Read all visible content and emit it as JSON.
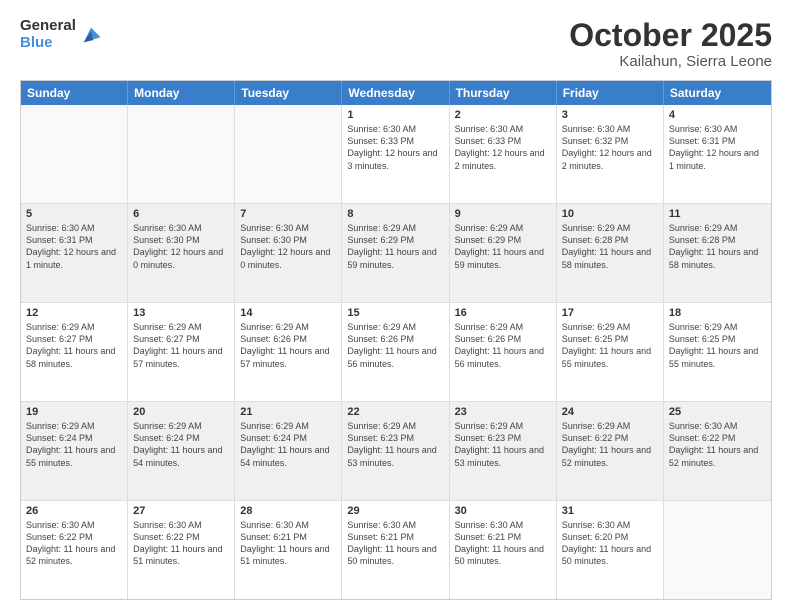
{
  "header": {
    "logo_general": "General",
    "logo_blue": "Blue",
    "title": "October 2025",
    "subtitle": "Kailahun, Sierra Leone"
  },
  "weekdays": [
    "Sunday",
    "Monday",
    "Tuesday",
    "Wednesday",
    "Thursday",
    "Friday",
    "Saturday"
  ],
  "rows": [
    [
      {
        "day": "",
        "text": "",
        "empty": true
      },
      {
        "day": "",
        "text": "",
        "empty": true
      },
      {
        "day": "",
        "text": "",
        "empty": true
      },
      {
        "day": "1",
        "text": "Sunrise: 6:30 AM\nSunset: 6:33 PM\nDaylight: 12 hours and 3 minutes.",
        "empty": false
      },
      {
        "day": "2",
        "text": "Sunrise: 6:30 AM\nSunset: 6:33 PM\nDaylight: 12 hours and 2 minutes.",
        "empty": false
      },
      {
        "day": "3",
        "text": "Sunrise: 6:30 AM\nSunset: 6:32 PM\nDaylight: 12 hours and 2 minutes.",
        "empty": false
      },
      {
        "day": "4",
        "text": "Sunrise: 6:30 AM\nSunset: 6:31 PM\nDaylight: 12 hours and 1 minute.",
        "empty": false
      }
    ],
    [
      {
        "day": "5",
        "text": "Sunrise: 6:30 AM\nSunset: 6:31 PM\nDaylight: 12 hours and 1 minute.",
        "empty": false,
        "shaded": true
      },
      {
        "day": "6",
        "text": "Sunrise: 6:30 AM\nSunset: 6:30 PM\nDaylight: 12 hours and 0 minutes.",
        "empty": false,
        "shaded": true
      },
      {
        "day": "7",
        "text": "Sunrise: 6:30 AM\nSunset: 6:30 PM\nDaylight: 12 hours and 0 minutes.",
        "empty": false,
        "shaded": true
      },
      {
        "day": "8",
        "text": "Sunrise: 6:29 AM\nSunset: 6:29 PM\nDaylight: 11 hours and 59 minutes.",
        "empty": false,
        "shaded": true
      },
      {
        "day": "9",
        "text": "Sunrise: 6:29 AM\nSunset: 6:29 PM\nDaylight: 11 hours and 59 minutes.",
        "empty": false,
        "shaded": true
      },
      {
        "day": "10",
        "text": "Sunrise: 6:29 AM\nSunset: 6:28 PM\nDaylight: 11 hours and 58 minutes.",
        "empty": false,
        "shaded": true
      },
      {
        "day": "11",
        "text": "Sunrise: 6:29 AM\nSunset: 6:28 PM\nDaylight: 11 hours and 58 minutes.",
        "empty": false,
        "shaded": true
      }
    ],
    [
      {
        "day": "12",
        "text": "Sunrise: 6:29 AM\nSunset: 6:27 PM\nDaylight: 11 hours and 58 minutes.",
        "empty": false
      },
      {
        "day": "13",
        "text": "Sunrise: 6:29 AM\nSunset: 6:27 PM\nDaylight: 11 hours and 57 minutes.",
        "empty": false
      },
      {
        "day": "14",
        "text": "Sunrise: 6:29 AM\nSunset: 6:26 PM\nDaylight: 11 hours and 57 minutes.",
        "empty": false
      },
      {
        "day": "15",
        "text": "Sunrise: 6:29 AM\nSunset: 6:26 PM\nDaylight: 11 hours and 56 minutes.",
        "empty": false
      },
      {
        "day": "16",
        "text": "Sunrise: 6:29 AM\nSunset: 6:26 PM\nDaylight: 11 hours and 56 minutes.",
        "empty": false
      },
      {
        "day": "17",
        "text": "Sunrise: 6:29 AM\nSunset: 6:25 PM\nDaylight: 11 hours and 55 minutes.",
        "empty": false
      },
      {
        "day": "18",
        "text": "Sunrise: 6:29 AM\nSunset: 6:25 PM\nDaylight: 11 hours and 55 minutes.",
        "empty": false
      }
    ],
    [
      {
        "day": "19",
        "text": "Sunrise: 6:29 AM\nSunset: 6:24 PM\nDaylight: 11 hours and 55 minutes.",
        "empty": false,
        "shaded": true
      },
      {
        "day": "20",
        "text": "Sunrise: 6:29 AM\nSunset: 6:24 PM\nDaylight: 11 hours and 54 minutes.",
        "empty": false,
        "shaded": true
      },
      {
        "day": "21",
        "text": "Sunrise: 6:29 AM\nSunset: 6:24 PM\nDaylight: 11 hours and 54 minutes.",
        "empty": false,
        "shaded": true
      },
      {
        "day": "22",
        "text": "Sunrise: 6:29 AM\nSunset: 6:23 PM\nDaylight: 11 hours and 53 minutes.",
        "empty": false,
        "shaded": true
      },
      {
        "day": "23",
        "text": "Sunrise: 6:29 AM\nSunset: 6:23 PM\nDaylight: 11 hours and 53 minutes.",
        "empty": false,
        "shaded": true
      },
      {
        "day": "24",
        "text": "Sunrise: 6:29 AM\nSunset: 6:22 PM\nDaylight: 11 hours and 52 minutes.",
        "empty": false,
        "shaded": true
      },
      {
        "day": "25",
        "text": "Sunrise: 6:30 AM\nSunset: 6:22 PM\nDaylight: 11 hours and 52 minutes.",
        "empty": false,
        "shaded": true
      }
    ],
    [
      {
        "day": "26",
        "text": "Sunrise: 6:30 AM\nSunset: 6:22 PM\nDaylight: 11 hours and 52 minutes.",
        "empty": false
      },
      {
        "day": "27",
        "text": "Sunrise: 6:30 AM\nSunset: 6:22 PM\nDaylight: 11 hours and 51 minutes.",
        "empty": false
      },
      {
        "day": "28",
        "text": "Sunrise: 6:30 AM\nSunset: 6:21 PM\nDaylight: 11 hours and 51 minutes.",
        "empty": false
      },
      {
        "day": "29",
        "text": "Sunrise: 6:30 AM\nSunset: 6:21 PM\nDaylight: 11 hours and 50 minutes.",
        "empty": false
      },
      {
        "day": "30",
        "text": "Sunrise: 6:30 AM\nSunset: 6:21 PM\nDaylight: 11 hours and 50 minutes.",
        "empty": false
      },
      {
        "day": "31",
        "text": "Sunrise: 6:30 AM\nSunset: 6:20 PM\nDaylight: 11 hours and 50 minutes.",
        "empty": false
      },
      {
        "day": "",
        "text": "",
        "empty": true
      }
    ]
  ]
}
